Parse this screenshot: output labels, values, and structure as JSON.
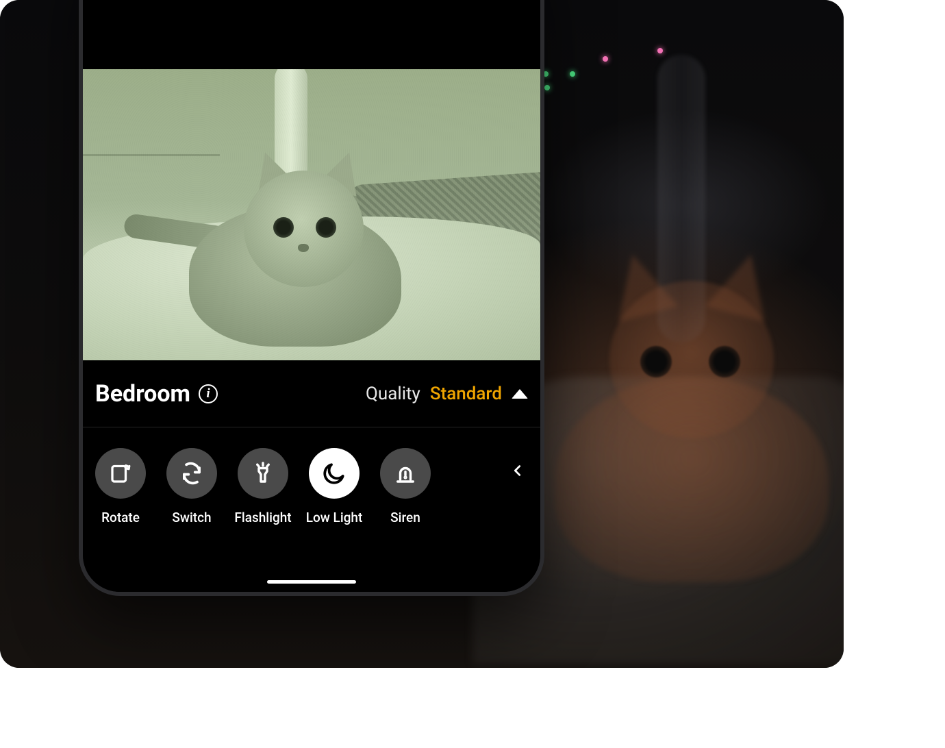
{
  "camera": {
    "name": "Bedroom"
  },
  "quality": {
    "label": "Quality",
    "value": "Standard"
  },
  "toolbar": {
    "rotate": "Rotate",
    "switch": "Switch",
    "flashlight": "Flashlight",
    "lowlight": "Low Light",
    "siren": "Siren",
    "active": "lowlight"
  },
  "colors": {
    "accent": "#f0a500",
    "tool_bg": "#4a4a4a",
    "tool_active_bg": "#ffffff"
  }
}
